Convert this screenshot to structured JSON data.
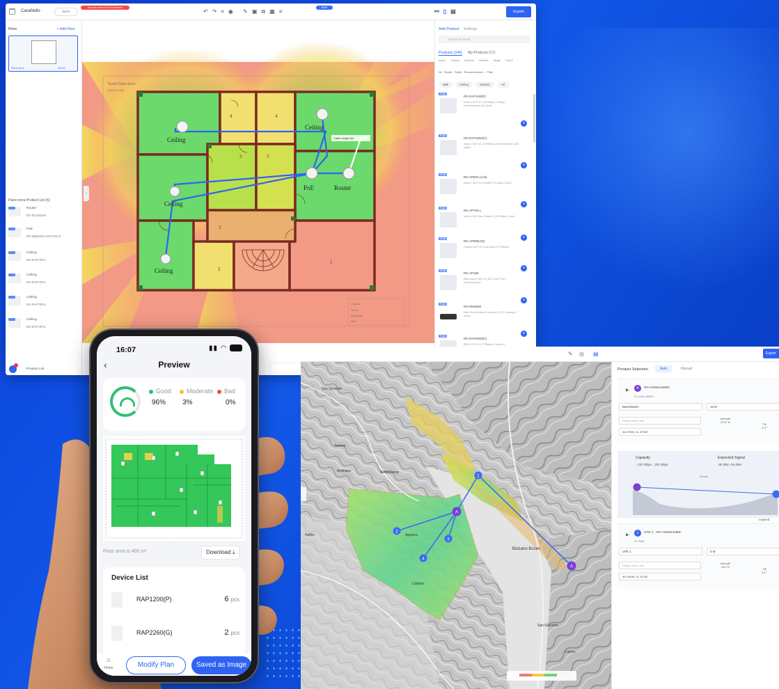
{
  "planner": {
    "project": "CasaNello",
    "mode_pill": "Wi-Fi",
    "warning": "Activate license for full features",
    "new_badge": "NEW",
    "export": "Export",
    "floor_header": "Floor",
    "add_floor": "+ Add Floor",
    "floor_thumb_name": "Piano terra",
    "floor_thumb_tag": "1Floor",
    "product_list_title": "Piano terra Product List (6)",
    "product_list_button": "Product List",
    "tag": "Ruijie",
    "products": [
      {
        "name": "Router",
        "model": "RG-EG105GW"
      },
      {
        "name": "PoE",
        "model": "RG-NBS5200-24GT4XS-P"
      },
      {
        "name": "Ceiling",
        "model": "RG-RAP72Pro"
      },
      {
        "name": "Ceiling",
        "model": "RG-RAP72Pro"
      },
      {
        "name": "Ceiling",
        "model": "RG-RAP72Pro"
      },
      {
        "name": "Ceiling",
        "model": "RG-RAP72Pro"
      }
    ],
    "right_panel": {
      "tab_add": "Add Product",
      "tab_settings": "Settings",
      "search_placeholder": "Search Products",
      "tab_products": "Products (246)",
      "tab_my_products": "My Products (17)",
      "categories": "Indoor Outdoor Wireless Wireless Bridge Switch",
      "filter_text": "All · Reyee · Ruijie · Recommended ... Filter",
      "chips": [
        "Wall",
        "Ceiling",
        "Outdoor",
        "AC"
      ],
      "cards": [
        {
          "tag": "Ruijie",
          "name": "RG-RAP1200(F)",
          "desc": "Indoor | Wi-Fi 5 | 1267Mbps | Ceiling | Recommended 30 clients"
        },
        {
          "tag": "Ruijie",
          "name": "RG-RAP2260(G)",
          "desc": "Indoor | Wi-Fi 6 | 1775Mbps | Recommended 128 clients"
        },
        {
          "tag": "Ruijie",
          "name": "RG-AP820-L(V3)",
          "desc": "Indoor | Wi-Fi 6 | AX3000 | Tri-radio | Cloud"
        },
        {
          "tag": "Ruijie",
          "name": "RG-AP720-L",
          "desc": "Indoor | 802.11ac | Wave2 | 1167Mbps | Cloud"
        },
        {
          "tag": "Ruijie",
          "name": "RG-AP880(CD)",
          "desc": "Outdoor Wi-Fi 6 | Dual-radio | 1775Mbps"
        },
        {
          "tag": "Ruijie",
          "name": "RG-AP180",
          "desc": "Wall-mount | Wi-Fi 6 | 802.11ax | PoE | Recommended"
        },
        {
          "tag": "Ruijie",
          "name": "RG-WS6008",
          "desc": "Next Gen Wireless Controller | 8 GE | Manage 1 series"
        },
        {
          "tag": "Ruijie",
          "name": "RG-RAP6260(G)",
          "desc": "IP68 | Wi-Fi 6 | 1775Mbps | Outdoor | Recommended"
        }
      ]
    },
    "floor_plan": {
      "title_line1": "Tavola Piano terra",
      "title_line2": "SCALA 1:100",
      "labels": {
        "ceiling": "Ceiling",
        "poe": "PoE",
        "router": "Router",
        "uplink": "Cable length 8m"
      },
      "room_numbers": [
        "4",
        "4",
        "3",
        "3",
        "3",
        "2",
        "1"
      ],
      "legend": [
        "Legend",
        "Good",
        "Moderate",
        "Bad"
      ]
    }
  },
  "phone": {
    "time": "16:07",
    "title": "Preview",
    "legend": [
      {
        "label": "Good",
        "value": "96%",
        "color": "#2fbf71"
      },
      {
        "label": "Moderate",
        "value": "3%",
        "color": "#f2c230"
      },
      {
        "label": "Bad",
        "value": "0%",
        "color": "#ee4b4b"
      }
    ],
    "floor_area": "Floor area is 400 m²",
    "download": "Download",
    "device_list_title": "Device List",
    "devices": [
      {
        "name": "RAP1200(P)",
        "qty": "6",
        "unit": "pcs"
      },
      {
        "name": "RAP2260(G)",
        "qty": "2",
        "unit": "pcs"
      }
    ],
    "home_label": "Home",
    "modify": "Modify Plan",
    "save": "Saved as Image"
  },
  "map": {
    "export": "Export",
    "product_selection": "Product Selection",
    "mode_auto": "Auto",
    "mode_manual": "Manual",
    "device_a": {
      "badge": "A",
      "name": "RG-AirMetro460G",
      "sub": "5G 8dBi 60MHz",
      "field_name": "BaseStation",
      "field_height": "16 M",
      "placeholder": "Please enter note",
      "coords": "46.4795N, 11.3733E",
      "azimuth_label": "Azimuth",
      "azimuth": "22.8 °N",
      "tilt_label": "Tilt",
      "tilt": "-1.6 °"
    },
    "capacity": {
      "title": "Capacity",
      "values": "↑ 202 Mbps  ↓ 202 Mbps",
      "signal_title": "Expected Signal",
      "signal_values": "-55 dBm  -55 dBm",
      "distance": "6.8 km"
    },
    "legend": "Legend",
    "device_1": {
      "badge": "1",
      "name": "CPE 1 · RG-AirMetro460F",
      "sub": "5G 8dBi",
      "field_name": "CPE 1",
      "field_height": "6 M",
      "placeholder": "Please enter note",
      "coords": "46.4290N, 11.3124E",
      "azimuth_label": "Azimuth",
      "azimuth": "120 °E",
      "tilt_label": "Tilt",
      "tilt": "2.0 °"
    },
    "places": [
      "Bolzano Bozen",
      "San Genesio",
      "Terlano",
      "Andriano",
      "Appiano",
      "Settequerce",
      "Nalles",
      "Caldaro",
      "San Giacomo",
      "Laives"
    ],
    "markers": [
      {
        "badge": "A"
      },
      {
        "badge": "A"
      },
      {
        "badge": "1"
      },
      {
        "badge": "2"
      },
      {
        "badge": "3"
      },
      {
        "badge": "4"
      }
    ]
  }
}
